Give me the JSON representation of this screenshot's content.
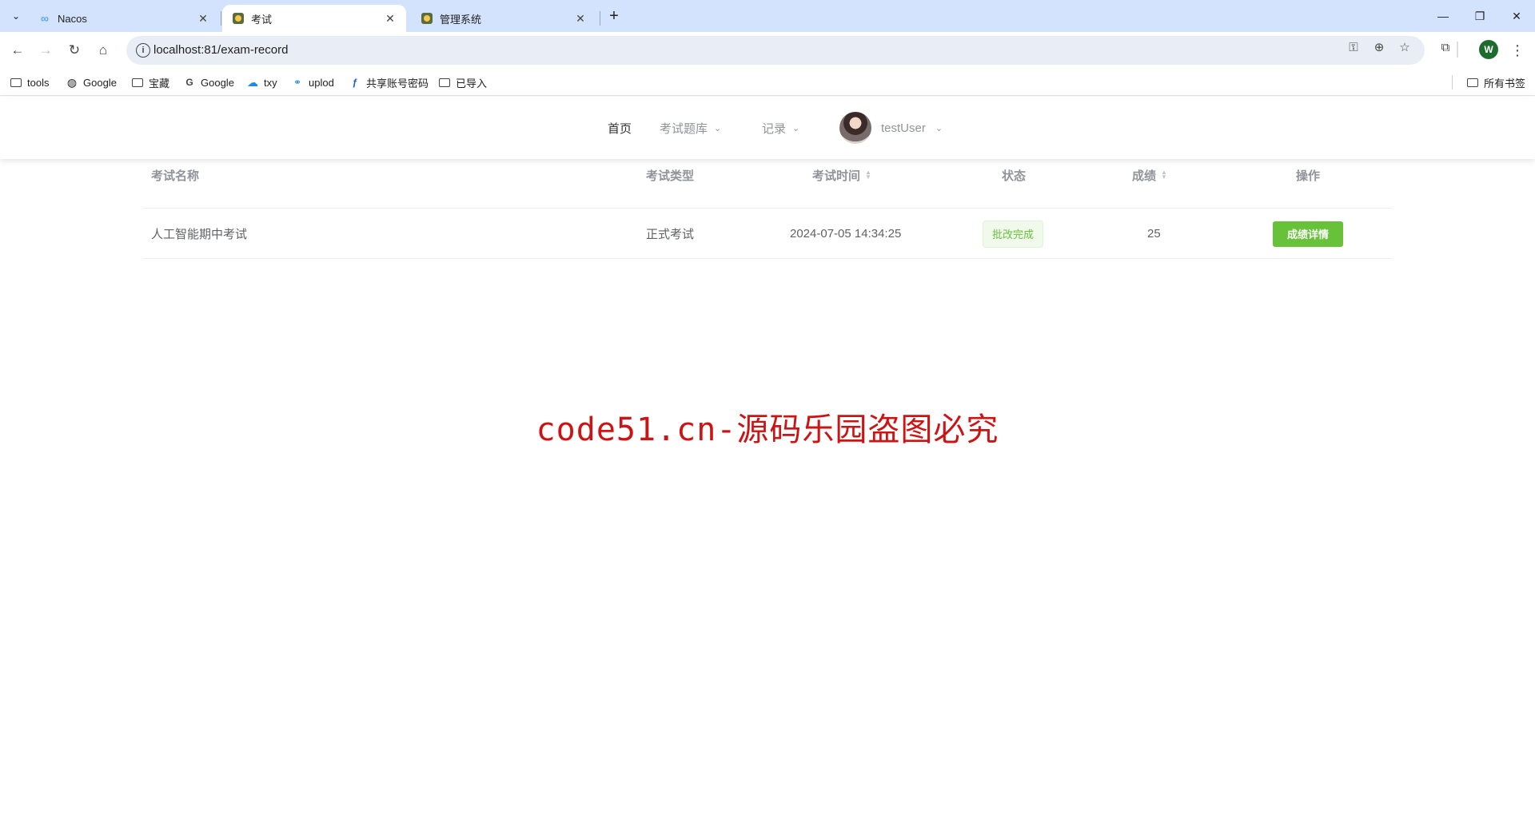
{
  "browser": {
    "tabs": [
      {
        "title": "Nacos",
        "icon": "infinity-icon"
      },
      {
        "title": "考试",
        "icon": "app-favicon",
        "active": true
      },
      {
        "title": "管理系统",
        "icon": "app-favicon"
      }
    ],
    "url": "localhost:81/exam-record",
    "profile_initial": "W",
    "bookmarks": [
      {
        "label": "tools",
        "icon": "folder-icon"
      },
      {
        "label": "Google",
        "icon": "globe-icon"
      },
      {
        "label": "宝藏",
        "icon": "folder-icon"
      },
      {
        "label": "Google",
        "icon": "google-icon"
      },
      {
        "label": "txy",
        "icon": "cloud-icon"
      },
      {
        "label": "uplod",
        "icon": "link-icon"
      },
      {
        "label": "共享账号密码",
        "icon": "bookmark-app-icon"
      },
      {
        "label": "已导入",
        "icon": "folder-icon"
      }
    ],
    "all_bookmarks": "所有书签"
  },
  "header": {
    "nav": [
      {
        "label": "首页"
      },
      {
        "label": "考试题库"
      },
      {
        "label": "记录"
      }
    ],
    "username": "testUser"
  },
  "table": {
    "columns": [
      "考试名称",
      "考试类型",
      "考试时间",
      "状态",
      "成绩",
      "操作"
    ],
    "rows": [
      {
        "name": "人工智能期中考试",
        "type": "正式考试",
        "time": "2024-07-05 14:34:25",
        "status": "批改完成",
        "score": "25",
        "action": "成绩详情"
      }
    ]
  },
  "watermark": "code51.cn-源码乐园盗图必究",
  "colors": {
    "accent_green": "#67c23a",
    "watermark_red": "#cc1414",
    "tabbar_bg": "#d3e3fd"
  }
}
